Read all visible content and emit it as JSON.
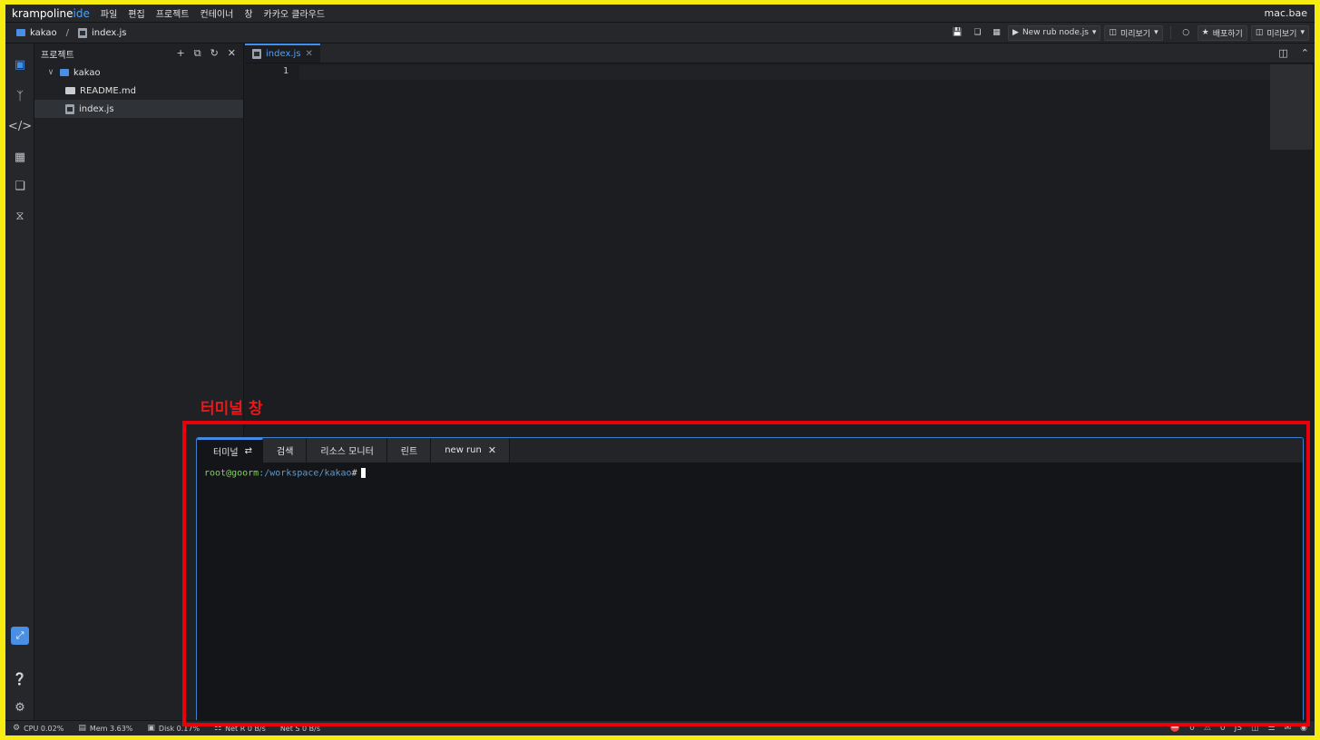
{
  "menubar": {
    "brand_main": "krampoline",
    "brand_ide": "ide",
    "items": [
      "파일",
      "편집",
      "프로젝트",
      "컨테이너",
      "창",
      "카카오 클라우드"
    ],
    "user": "mac.bae"
  },
  "breadcrumb": {
    "project": "kakao",
    "separator": "/",
    "file": "index.js"
  },
  "toolbar": {
    "run_label": "New rub node.js",
    "preview_label": "미리보기",
    "deploy_label": "배포하기",
    "preview2_label": "미리보기"
  },
  "project_panel": {
    "title": "프로젝트",
    "root": "kakao",
    "files": [
      "README.md",
      "index.js"
    ]
  },
  "editor": {
    "tab_label": "index.js",
    "line_number": "1"
  },
  "annotation": {
    "label": "터미널 창"
  },
  "terminal": {
    "tabs": [
      "터미널",
      "검색",
      "리소스 모니터",
      "린트",
      "new run"
    ],
    "prompt_user": "root@goorm",
    "prompt_path": ":/workspace/kakao",
    "prompt_symbol": "#"
  },
  "statusbar": {
    "cpu": "CPU 0.02%",
    "mem": "Mem 3.63%",
    "disk": "Disk 0.17%",
    "net_r": "Net R 0 B/s",
    "net_s": "Net S 0 B/s",
    "errors": "0",
    "warnings": "0",
    "lang": "JS"
  },
  "colors": {
    "accent": "#3f8ff0",
    "annotation": "#e8000a",
    "outer_border": "#f7ec12"
  }
}
